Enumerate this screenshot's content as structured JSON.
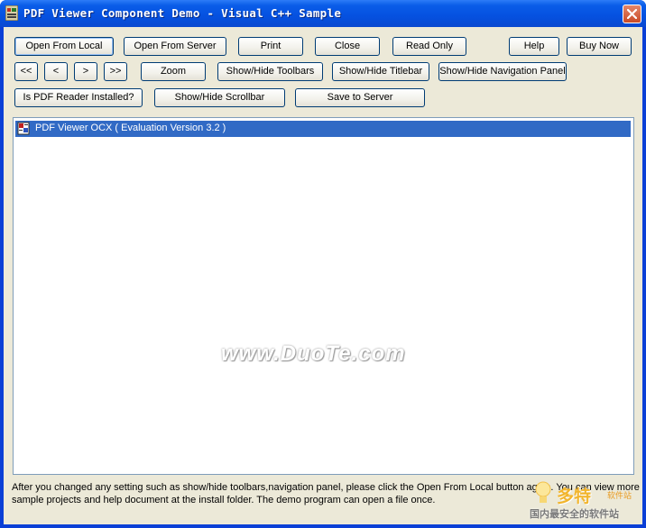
{
  "window": {
    "title": "PDF Viewer Component Demo - Visual C++ Sample"
  },
  "toolbar": {
    "row1": {
      "open_local": "Open From Local",
      "open_server": "Open From Server",
      "print": "Print",
      "close": "Close",
      "read_only": "Read Only",
      "help": "Help",
      "buy_now": "Buy Now"
    },
    "row2": {
      "first_page": "<<",
      "prev_page": "<",
      "next_page": ">",
      "last_page": ">>",
      "zoom": "Zoom",
      "toggle_toolbars": "Show/Hide Toolbars",
      "toggle_titlebar": "Show/Hide Titlebar",
      "toggle_nav_panel": "Show/Hide Navigation Panel"
    },
    "row3": {
      "is_reader_installed": "Is PDF Reader Installed?",
      "toggle_scrollbar": "Show/Hide Scrollbar",
      "save_to_server": "Save to Server"
    }
  },
  "viewer": {
    "item_label": "PDF Viewer OCX ( Evaluation Version 3.2 )",
    "watermark": "www.DuoTe.com"
  },
  "footer": {
    "line1": "After you changed any setting such as show/hide toolbars,navigation panel, please click the Open From Local button again. You can view more",
    "line2": "sample projects and help document at the install folder. The demo program can open a file once."
  },
  "corner_logo": {
    "big": "多特",
    "small": "软件站",
    "tag": "国内最安全的软件站"
  },
  "colors": {
    "titlebar": "#0a5de8",
    "client_bg": "#ece9d8",
    "selection": "#316ac5",
    "close_button": "#c94a26"
  }
}
